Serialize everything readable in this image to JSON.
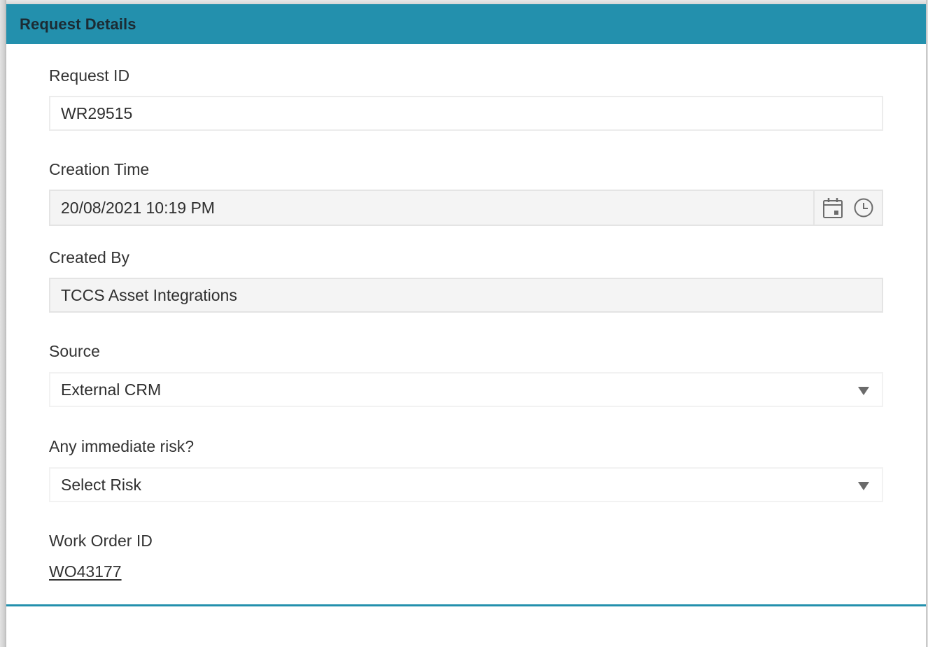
{
  "panel": {
    "title": "Request Details",
    "accent_color": "#2390ad"
  },
  "fields": {
    "request_id": {
      "label": "Request ID",
      "value": "WR29515"
    },
    "creation_time": {
      "label": "Creation Time",
      "value": "20/08/2021 10:19 PM",
      "icons": [
        "calendar-icon",
        "clock-icon"
      ]
    },
    "created_by": {
      "label": "Created By",
      "value": "TCCS Asset Integrations"
    },
    "source": {
      "label": "Source",
      "value": "External CRM"
    },
    "immediate_risk": {
      "label": "Any immediate risk?",
      "value": "Select Risk"
    },
    "work_order_id": {
      "label": "Work Order ID",
      "value": "WO43177"
    }
  }
}
